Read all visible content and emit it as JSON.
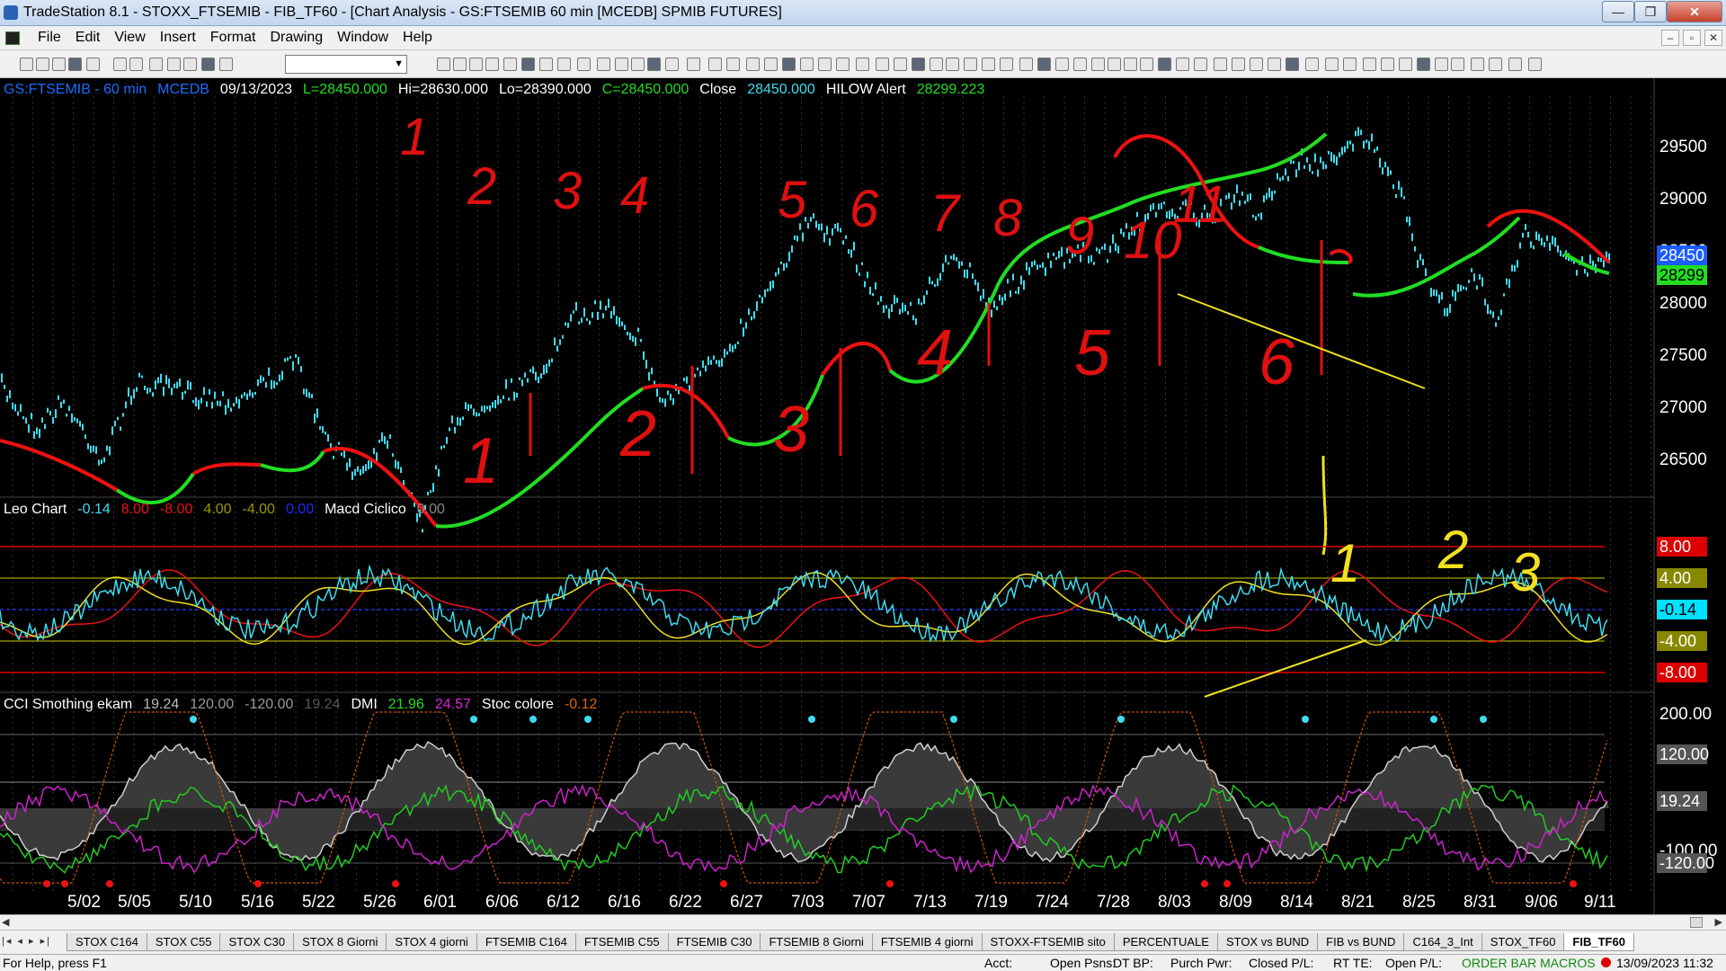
{
  "window": {
    "title": "TradeStation 8.1 - STOXX_FTSEMIB - FIB_TF60 - [Chart Analysis - GS:FTSEMIB  60 min  [MCEDB] SPMIB FUTURES]",
    "min_label": "—",
    "max_label": "❐",
    "close_label": "✕"
  },
  "menu": {
    "items": [
      "File",
      "Edit",
      "View",
      "Insert",
      "Format",
      "Drawing",
      "Window",
      "Help"
    ],
    "mdi_min": "–",
    "mdi_restore": "▫",
    "mdi_close": "✕"
  },
  "toolbar": {
    "combo_value": ""
  },
  "header_main": {
    "symbol": "GS:FTSEMIB - 60 min",
    "feed": "MCEDB",
    "date": "09/13/2023",
    "last": "L=28450.000",
    "high": "Hi=28630.000",
    "low": "Lo=28390.000",
    "close": "C=28450.000",
    "close_label": "Close",
    "close_value": "28450.000",
    "alert_label": "HILOW Alert",
    "alert_value": "28299.223"
  },
  "header_sub1": {
    "name": "Leo Chart",
    "v1": "-0.14",
    "v2": "8.00",
    "v3": "-8.00",
    "v4": "4.00",
    "v5": "-4.00",
    "v6": "0.00",
    "name2": "Macd Ciclico",
    "v7": "0.00"
  },
  "header_sub2": {
    "name": "CCI Smothing ekam",
    "v1": "19.24",
    "v2": "120.00",
    "v3": "-120.00",
    "v4": "19.24",
    "name2": "DMI",
    "v5": "21.96",
    "v6": "24.57",
    "name3": "Stoc colore",
    "v7": "-0.12"
  },
  "price_axis": [
    "29500",
    "29000",
    "28500",
    "28000",
    "27500",
    "27000",
    "26500"
  ],
  "price_boxes": {
    "last": "28450",
    "alert": "28299"
  },
  "sub1_axis": [
    "8.00",
    "4.00",
    "-0.14",
    "-4.00",
    "-8.00"
  ],
  "sub2_axis": [
    "200.00",
    "120.00",
    "19.24",
    "-100.00",
    "-120.00"
  ],
  "dates": [
    "5/02",
    "5/05",
    "5/10",
    "5/16",
    "5/22",
    "5/26",
    "6/01",
    "6/06",
    "6/12",
    "6/16",
    "6/22",
    "6/27",
    "7/03",
    "7/07",
    "7/13",
    "7/19",
    "7/24",
    "7/28",
    "8/03",
    "8/09",
    "8/14",
    "8/21",
    "8/25",
    "8/31",
    "9/06",
    "9/11"
  ],
  "annotations_price": [
    "1",
    "2",
    "3",
    "4",
    "5",
    "6"
  ],
  "annotations_sub": [
    "1",
    "2",
    "3",
    "4",
    "5",
    "6",
    "7",
    "8",
    "9",
    "10",
    "11"
  ],
  "annotations_yellow": [
    "1",
    "2",
    "3"
  ],
  "colors": {
    "price_bars": "#3fdcf0",
    "trend_up": "#22dd22",
    "trend_down": "#ee1111",
    "annotation_red": "#e01010",
    "annotation_yellow": "#f0e020",
    "dmi_plus": "#22cc22",
    "dmi_minus": "#cc22cc",
    "stoc": "#cc5500",
    "box_last": "#1a5cff",
    "box_alert": "#22dd22",
    "box_red": "#dd0000",
    "box_olive": "#888800",
    "box_cyan": "#00e0ff",
    "box_gray": "#555555"
  },
  "tabs": [
    "STOX C164",
    "STOX C55",
    "STOX  C30",
    "STOX  8 Giorni",
    "STOX 4 giorni",
    "FTSEMIB C164",
    "FTSEMIB C55",
    "FTSEMIB C30",
    "FTSEMIB  8 Giorni",
    "FTSEMIB  4 giorni",
    "STOXX-FTSEMIB sito",
    "PERCENTUALE",
    "STOX vs BUND",
    "FIB vs BUND",
    "C164_3_Int",
    "STOX_TF60",
    "FIB_TF60"
  ],
  "tab_nav": "|◂ ◂ ▸ ▸|",
  "status": {
    "help": "For Help, press F1",
    "acct": "Acct:",
    "open_psns": "Open Psns:",
    "dt_bp": "DT BP:",
    "purch_pwr": "Purch Pwr:",
    "closed_pl": "Closed P/L:",
    "rt_te": "RT TE:",
    "open_pl": "Open P/L:",
    "macros": "ORDER BAR  MACROS",
    "datetime": "13/09/2023 11:32"
  }
}
